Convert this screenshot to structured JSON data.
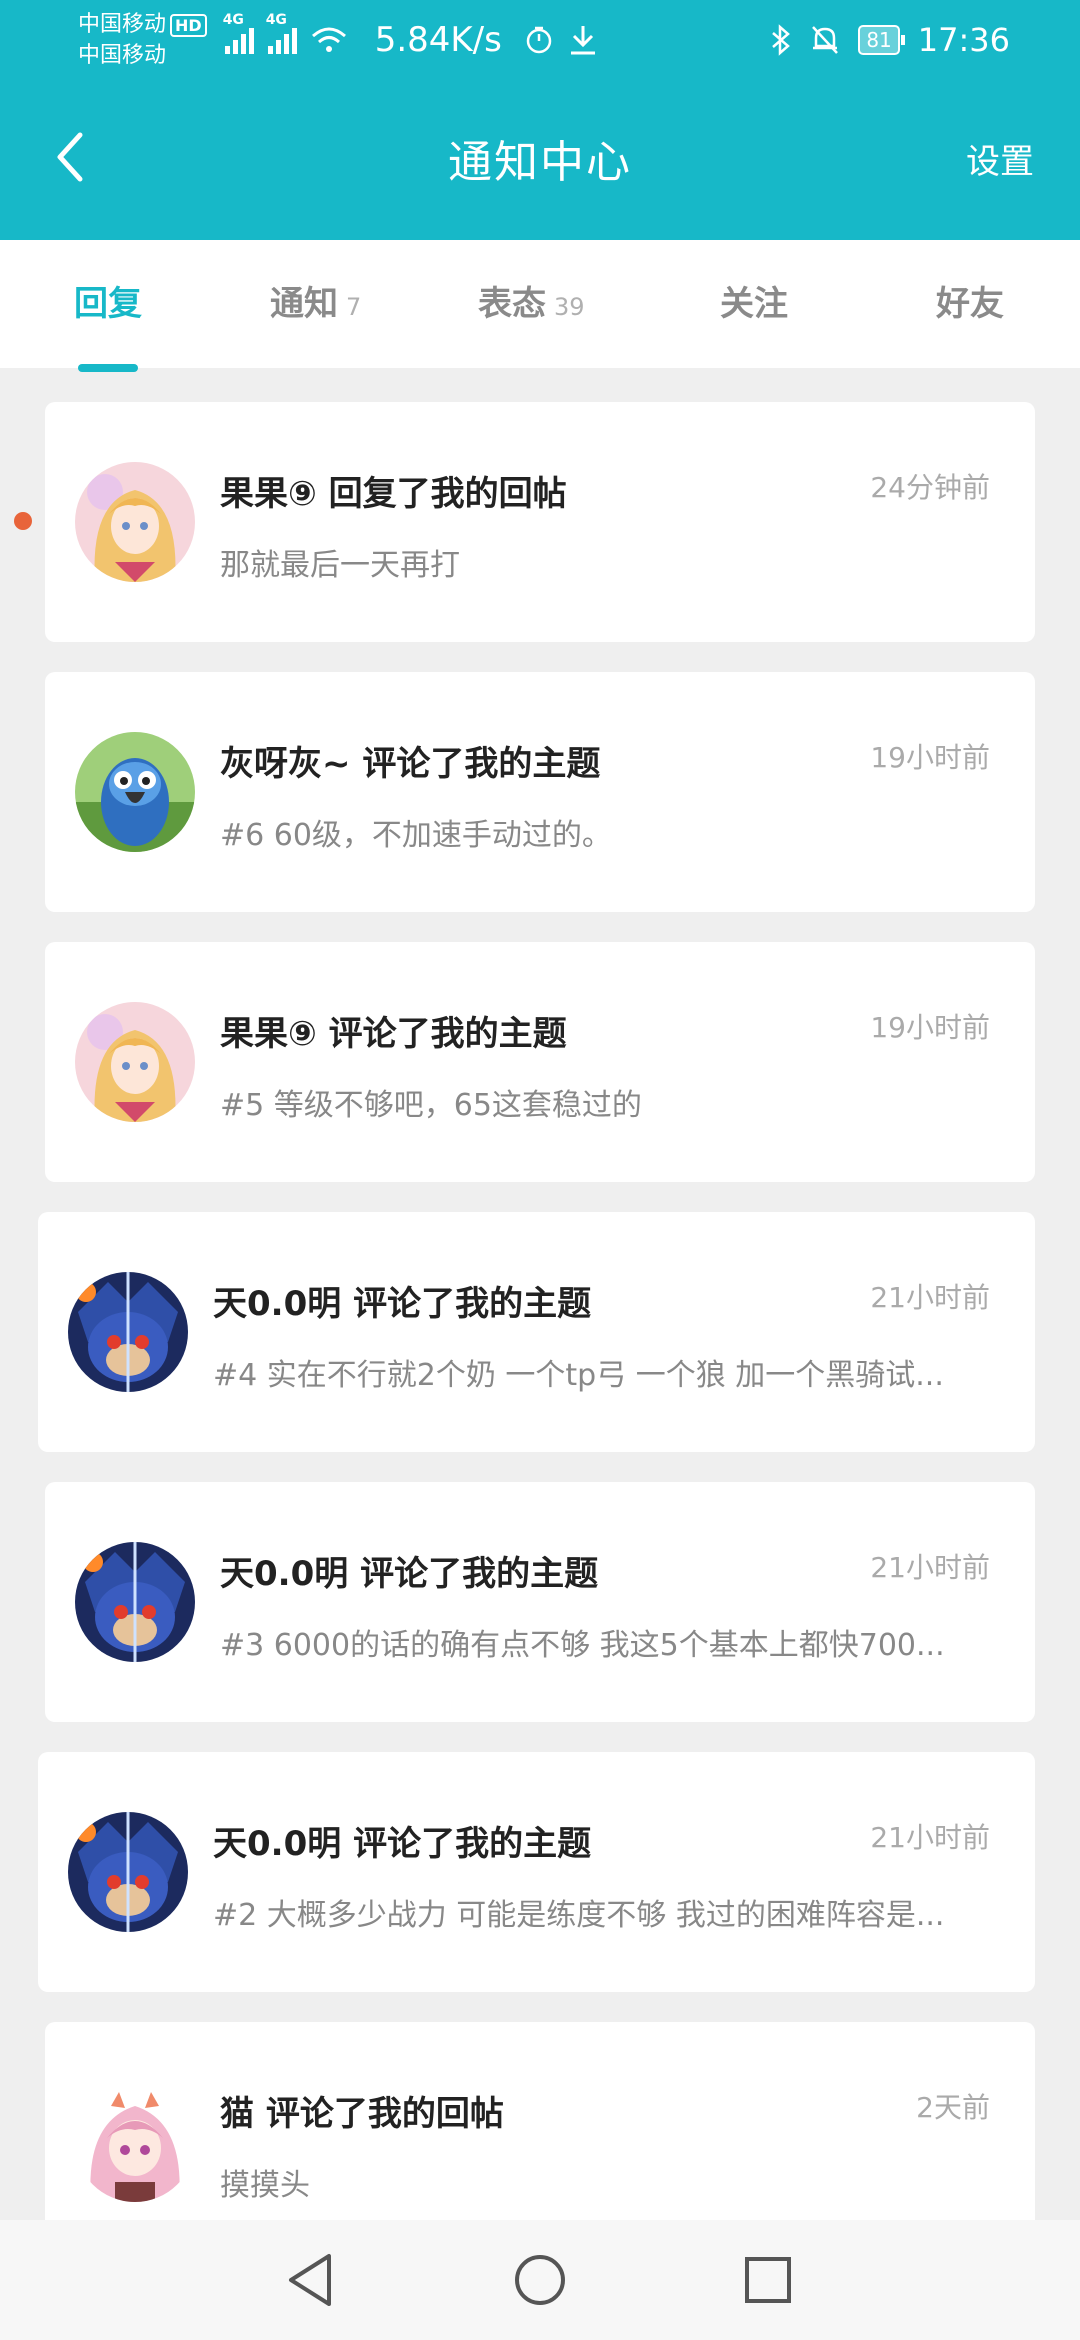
{
  "status_bar": {
    "carrier_1": "中国移动",
    "hd": "HD",
    "carrier_2": "中国移动",
    "network_1": "4G",
    "network_2": "4G",
    "speed": "5.84K/s",
    "battery": "81",
    "time": "17:36"
  },
  "app_bar": {
    "title": "通知中心",
    "settings_label": "设置"
  },
  "tabs": [
    {
      "label": "回复",
      "count": ""
    },
    {
      "label": "通知",
      "count": "7"
    },
    {
      "label": "表态",
      "count": "39"
    },
    {
      "label": "关注",
      "count": ""
    },
    {
      "label": "好友",
      "count": ""
    }
  ],
  "notifications": [
    {
      "title": "果果⑨ 回复了我的回帖",
      "time": "24分钟前",
      "preview": "那就最后一天再打",
      "avatar": "anime-girl-avatar"
    },
    {
      "title": "灰呀灰~ 评论了我的主题",
      "time": "19小时前",
      "preview": "#6 60级，不加速手动过的。",
      "avatar": "blue-bird-avatar"
    },
    {
      "title": "果果⑨ 评论了我的主题",
      "time": "19小时前",
      "preview": "#5 等级不够吧，65这套稳过的",
      "avatar": "anime-girl-avatar"
    },
    {
      "title": "天0.0明 评论了我的主题",
      "time": "21小时前",
      "preview": "#4 实在不行就2个奶 一个tp弓 一个狼 加一个黑骑试...",
      "avatar": "sonic-avatar"
    },
    {
      "title": "天0.0明 评论了我的主题",
      "time": "21小时前",
      "preview": "#3 6000的话的确有点不够 我这5个基本上都快700...",
      "avatar": "sonic-avatar"
    },
    {
      "title": "天0.0明 评论了我的主题",
      "time": "21小时前",
      "preview": "#2 大概多少战力 可能是练度不够 我过的困难阵容是...",
      "avatar": "sonic-avatar"
    },
    {
      "title": "猫 评论了我的回帖",
      "time": "2天前",
      "preview": "摸摸头",
      "avatar": "pink-hair-girl-avatar"
    }
  ],
  "colors": {
    "accent": "#17b8c8",
    "unread_dot": "#e8643a"
  }
}
